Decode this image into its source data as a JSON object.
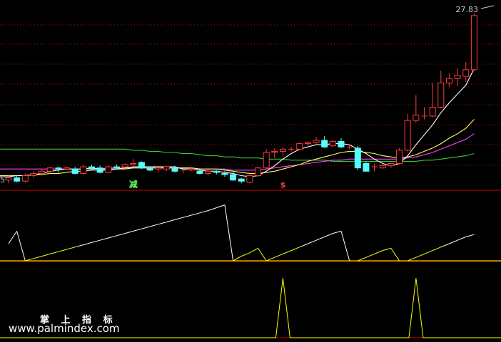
{
  "chart_data": {
    "type": "candlestick",
    "price_axis": {
      "top_label": "27.83",
      "left_partial_label": "5"
    },
    "colors": {
      "background": "#000000",
      "up": "#ff3b3b",
      "down": "#54ffff",
      "ma_short": "#ffffff",
      "ma_mid": "#ffff66",
      "ma_long": "#ff44ff",
      "ma_longest": "#33cc33",
      "panel_divider": "#cc0000",
      "gridline": "#aa1111",
      "indicator_line": "#ffffff",
      "indicator_line_low": "#ffff00",
      "pulse": "#ffff00",
      "signal_sell": "#66ff66",
      "signal_buy": "#ff4444"
    },
    "ylim": [
      11.8,
      28.2
    ],
    "candles": [
      [
        12.4,
        12.9,
        12.1,
        12.6
      ],
      [
        12.6,
        12.8,
        12.2,
        12.3
      ],
      [
        12.3,
        13.0,
        12.2,
        12.8
      ],
      [
        12.8,
        13.2,
        12.6,
        13.0
      ],
      [
        13.0,
        13.4,
        12.8,
        13.2
      ],
      [
        13.2,
        13.6,
        13.0,
        13.5
      ],
      [
        13.5,
        13.6,
        13.1,
        13.4
      ],
      [
        13.4,
        13.6,
        13.3,
        13.5
      ],
      [
        13.4,
        13.6,
        12.9,
        13.0
      ],
      [
        13.0,
        13.8,
        12.9,
        13.6
      ],
      [
        13.6,
        13.8,
        13.3,
        13.4
      ],
      [
        13.5,
        13.7,
        13.0,
        13.1
      ],
      [
        13.1,
        13.7,
        13.0,
        13.6
      ],
      [
        13.6,
        13.8,
        13.4,
        13.5
      ],
      [
        13.6,
        13.9,
        13.5,
        13.8
      ],
      [
        13.8,
        14.3,
        13.7,
        13.9
      ],
      [
        14.0,
        14.1,
        13.4,
        13.5
      ],
      [
        13.5,
        13.6,
        13.2,
        13.3
      ],
      [
        13.4,
        13.6,
        13.1,
        13.5
      ],
      [
        13.4,
        13.7,
        13.2,
        13.6
      ],
      [
        13.5,
        13.7,
        13.1,
        13.2
      ],
      [
        13.3,
        13.4,
        13.0,
        13.3
      ],
      [
        13.3,
        13.5,
        13.2,
        13.4
      ],
      [
        13.2,
        13.4,
        12.9,
        13.0
      ],
      [
        13.0,
        13.3,
        12.8,
        13.2
      ],
      [
        13.2,
        13.3,
        12.9,
        13.1
      ],
      [
        13.0,
        13.2,
        12.7,
        12.9
      ],
      [
        12.9,
        13.1,
        12.3,
        12.4
      ],
      [
        12.5,
        12.6,
        12.1,
        12.3
      ],
      [
        12.2,
        12.9,
        12.1,
        12.8
      ],
      [
        12.8,
        13.6,
        12.7,
        13.5
      ],
      [
        13.5,
        15.2,
        13.4,
        14.9
      ],
      [
        14.9,
        15.3,
        14.4,
        15.0
      ],
      [
        15.0,
        15.4,
        14.6,
        15.2
      ],
      [
        15.2,
        15.4,
        15.0,
        15.2
      ],
      [
        15.2,
        15.8,
        15.1,
        15.7
      ],
      [
        15.7,
        15.9,
        15.5,
        15.8
      ],
      [
        15.8,
        16.3,
        15.7,
        16.0
      ],
      [
        16.0,
        16.4,
        15.3,
        15.4
      ],
      [
        15.5,
        16.0,
        15.4,
        15.9
      ],
      [
        15.9,
        16.2,
        15.3,
        15.4
      ],
      [
        15.4,
        15.6,
        15.2,
        15.4
      ],
      [
        15.3,
        15.5,
        13.3,
        13.5
      ],
      [
        13.9,
        14.1,
        13.2,
        13.2
      ],
      [
        13.6,
        13.9,
        13.2,
        13.6
      ],
      [
        13.5,
        13.8,
        13.4,
        13.7
      ],
      [
        13.7,
        13.9,
        13.5,
        13.9
      ],
      [
        13.9,
        15.3,
        13.8,
        15.1
      ],
      [
        15.1,
        18.4,
        15.0,
        17.8
      ],
      [
        17.8,
        20.1,
        17.6,
        18.3
      ],
      [
        18.2,
        19.0,
        17.9,
        18.2
      ],
      [
        18.2,
        21.2,
        18.1,
        19.0
      ],
      [
        19.0,
        22.3,
        18.9,
        21.2
      ],
      [
        21.2,
        22.1,
        20.8,
        21.6
      ],
      [
        21.6,
        22.5,
        20.9,
        21.9
      ],
      [
        21.8,
        23.1,
        21.3,
        22.4
      ],
      [
        22.4,
        27.5,
        22.3,
        27.3
      ]
    ],
    "ma_lines": {
      "ma_short": [
        12.7,
        12.8,
        12.8,
        12.9,
        13.0,
        13.2,
        13.3,
        13.4,
        13.4,
        13.4,
        13.5,
        13.4,
        13.4,
        13.4,
        13.5,
        13.6,
        13.6,
        13.6,
        13.6,
        13.6,
        13.6,
        13.4,
        13.4,
        13.3,
        13.2,
        13.2,
        13.1,
        13.0,
        12.8,
        12.7,
        12.8,
        13.2,
        13.7,
        14.3,
        14.8,
        15.2,
        15.4,
        15.6,
        15.6,
        15.7,
        15.7,
        15.6,
        15.2,
        14.8,
        14.3,
        13.9,
        13.7,
        13.9,
        14.6,
        15.6,
        16.5,
        17.4,
        18.5,
        19.4,
        20.2,
        21.0,
        22.5
      ],
      "ma_mid": [
        12.8,
        12.8,
        12.8,
        12.9,
        12.9,
        13.0,
        13.0,
        13.1,
        13.2,
        13.2,
        13.3,
        13.3,
        13.3,
        13.4,
        13.4,
        13.5,
        13.5,
        13.5,
        13.5,
        13.5,
        13.5,
        13.5,
        13.5,
        13.4,
        13.4,
        13.4,
        13.3,
        13.2,
        13.1,
        13.0,
        13.0,
        13.1,
        13.2,
        13.4,
        13.6,
        13.8,
        14.1,
        14.3,
        14.5,
        14.7,
        14.9,
        15.0,
        15.0,
        14.9,
        14.8,
        14.6,
        14.5,
        14.4,
        14.5,
        14.7,
        15.0,
        15.3,
        15.7,
        16.2,
        16.6,
        17.1,
        17.9
      ],
      "ma_long": [
        13.4,
        13.4,
        13.4,
        13.4,
        13.4,
        13.4,
        13.4,
        13.4,
        13.4,
        13.4,
        13.4,
        13.4,
        13.5,
        13.5,
        13.5,
        13.5,
        13.5,
        13.5,
        13.5,
        13.5,
        13.5,
        13.5,
        13.5,
        13.4,
        13.4,
        13.4,
        13.4,
        13.3,
        13.3,
        13.3,
        13.3,
        13.4,
        13.5,
        13.6,
        13.7,
        13.8,
        13.9,
        14.0,
        14.1,
        14.2,
        14.2,
        14.3,
        14.3,
        14.3,
        14.3,
        14.3,
        14.3,
        14.3,
        14.4,
        14.5,
        14.7,
        14.9,
        15.2,
        15.5,
        15.8,
        16.1,
        16.6
      ],
      "ma_longest": [
        15.2,
        15.2,
        15.2,
        15.2,
        15.2,
        15.2,
        15.2,
        15.2,
        15.2,
        15.2,
        15.2,
        15.2,
        15.2,
        15.2,
        15.2,
        15.1,
        15.1,
        15.0,
        15.0,
        14.9,
        14.9,
        14.8,
        14.8,
        14.7,
        14.6,
        14.6,
        14.5,
        14.5,
        14.4,
        14.4,
        14.4,
        14.3,
        14.3,
        14.3,
        14.2,
        14.2,
        14.2,
        14.2,
        14.2,
        14.1,
        14.1,
        14.1,
        14.1,
        14.1,
        14.1,
        14.1,
        14.1,
        14.1,
        14.1,
        14.1,
        14.2,
        14.2,
        14.3,
        14.4,
        14.5,
        14.6,
        14.8
      ]
    },
    "signals": [
      {
        "index": 15,
        "text": "减",
        "kind": "sell"
      },
      {
        "index": 33,
        "text": "$",
        "kind": "buy"
      }
    ],
    "indicator": {
      "ylim": [
        0,
        1
      ],
      "values": [
        0.3,
        0.52,
        0.0,
        0.04,
        0.08,
        0.12,
        0.16,
        0.2,
        0.24,
        0.28,
        0.32,
        0.36,
        0.4,
        0.44,
        0.48,
        0.52,
        0.56,
        0.6,
        0.64,
        0.68,
        0.72,
        0.76,
        0.8,
        0.84,
        0.88,
        0.93,
        0.98,
        0.0,
        0.08,
        0.14,
        0.22,
        0.0,
        0.06,
        0.12,
        0.18,
        0.24,
        0.3,
        0.36,
        0.42,
        0.48,
        0.52,
        0.0,
        0.0,
        0.06,
        0.12,
        0.18,
        0.22,
        0.0,
        0.0,
        0.06,
        0.12,
        0.18,
        0.24,
        0.3,
        0.36,
        0.42,
        0.46
      ]
    },
    "pulse": {
      "ylim": [
        0,
        1
      ],
      "peaks_at": [
        33,
        49
      ],
      "peak_value": 0.95
    }
  },
  "watermark": {
    "line1": "掌 上 指 标",
    "line2": "www.palmindex.com"
  }
}
